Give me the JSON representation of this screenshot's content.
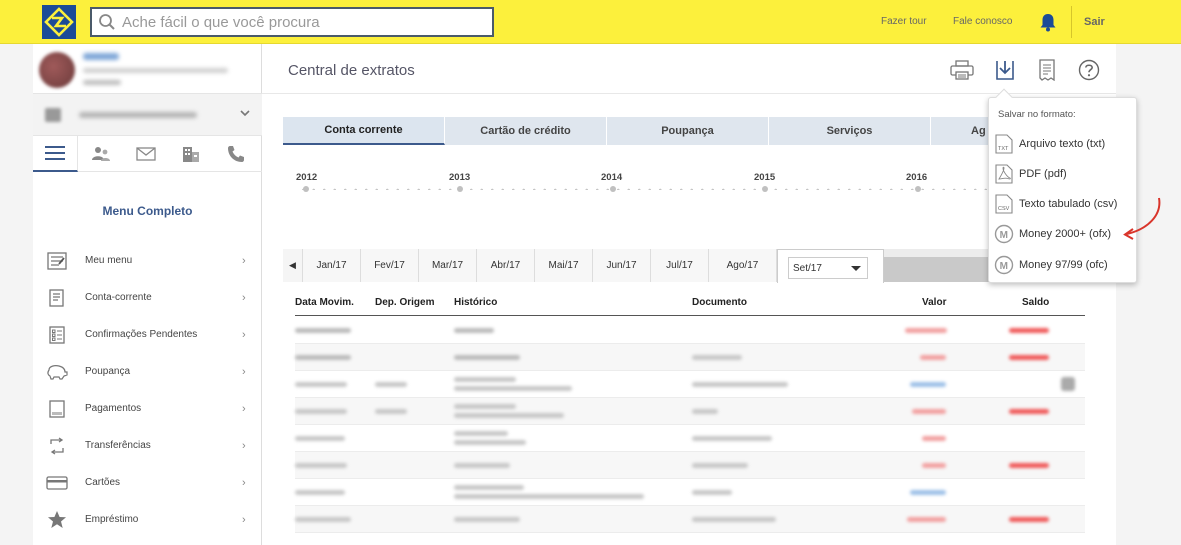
{
  "header": {
    "search_placeholder": "Ache fácil o que você procura",
    "links": [
      "Fazer tour",
      "Fale conosco"
    ],
    "logout": "Sair"
  },
  "sidebar": {
    "menu_title": "Menu Completo",
    "items": [
      {
        "label": "Meu menu",
        "icon": "my-menu-icon"
      },
      {
        "label": "Conta-corrente",
        "icon": "checking-account-icon"
      },
      {
        "label": "Confirmações Pendentes",
        "icon": "pending-list-icon"
      },
      {
        "label": "Poupança",
        "icon": "piggy-bank-icon"
      },
      {
        "label": "Pagamentos",
        "icon": "barcode-payment-icon"
      },
      {
        "label": "Transferências",
        "icon": "transfer-icon"
      },
      {
        "label": "Cartões",
        "icon": "card-icon"
      },
      {
        "label": "Empréstimo",
        "icon": "star-icon"
      }
    ],
    "arrow": "›"
  },
  "main": {
    "title": "Central de extratos",
    "tabs": [
      "Conta corrente",
      "Cartão de crédito",
      "Poupança",
      "Serviços",
      "Ag"
    ],
    "years": [
      "2012",
      "2013",
      "2014",
      "2015",
      "2016"
    ],
    "month_prev": "◀",
    "months": [
      "Jan/17",
      "Fev/17",
      "Mar/17",
      "Abr/17",
      "Mai/17",
      "Jun/17",
      "Jul/17",
      "Ago/17"
    ],
    "selected_month": "Set/17",
    "columns": [
      "Data Movim.",
      "Dep. Origem",
      "Histórico",
      "Documento",
      "Valor",
      "Saldo"
    ]
  },
  "export_menu": {
    "title": "Salvar no formato:",
    "options": [
      {
        "label": "Arquivo texto (txt)",
        "badge": "TXT"
      },
      {
        "label": "PDF (pdf)",
        "badge": ""
      },
      {
        "label": "Texto tabulado (csv)",
        "badge": "CSV"
      },
      {
        "label": "Money 2000+ (ofx)",
        "badge": "M"
      },
      {
        "label": "Money 97/99 (ofc)",
        "badge": "M"
      }
    ]
  },
  "colors": {
    "topbar": "#fcf03c",
    "brand_blue": "#1b4b97",
    "accent": "#3c5a8c",
    "annotation_red": "#d9352b"
  }
}
